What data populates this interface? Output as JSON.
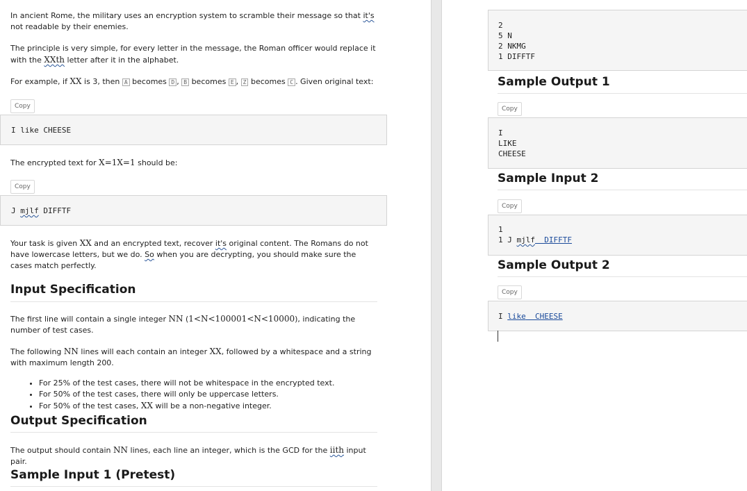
{
  "left": {
    "intro_a": "In ancient Rome, the military uses an encryption system to scramble their message so that ",
    "intro_its": "it's",
    "intro_b": " not readable by their enemies.",
    "principle_a": "The principle is very simple, for every letter in the message, the Roman officer would replace it with the ",
    "principle_xth": "XXth",
    "principle_b": " letter after it in the alphabet.",
    "example_a": "For example, if ",
    "example_x": "XX",
    "example_b": " is 3, then ",
    "kbd_A": "A",
    "becomes1": " becomes ",
    "kbd_D": "D",
    "sep1": ", ",
    "kbd_B": "B",
    "becomes2": " becomes ",
    "kbd_E": "E",
    "sep2": ", ",
    "kbd_Z": "Z",
    "becomes3": " becomes ",
    "kbd_C": "C",
    "example_c": ". Given original text:",
    "copy_label": "Copy",
    "code1": "I like CHEESE",
    "encrypted_a": "The encrypted text for ",
    "encrypted_math": "X=1X=1",
    "encrypted_b": " should be:",
    "code2_a": "J ",
    "code2_misspelled": "mjlf",
    "code2_b": " DIFFTF",
    "task_a": "Your task is given ",
    "task_x": "XX",
    "task_b": " and an encrypted text, recover ",
    "task_its": "it's",
    "task_c": " original content. The Romans do not have lowercase letters, but we do. ",
    "task_so": "So",
    "task_d": " when you are decrypting, you should make sure the cases match perfectly.",
    "input_heading": "Input Specification",
    "input1_a": "The first line will contain a single integer ",
    "input1_n": "NN",
    "input1_paren": " (",
    "input1_math": "1<N<100001<N<10000",
    "input1_b": "), indicating the number of test cases.",
    "input2_a": "The following ",
    "input2_n": "NN",
    "input2_b": " lines will each contain an integer ",
    "input2_x": "XX",
    "input2_c": ", followed by a whitespace and a string with maximum length 200.",
    "bullets": [
      "For 25% of the test cases, there will not be whitespace in the encrypted text.",
      "For 50% of the test cases, there will only be uppercase letters."
    ],
    "bullet3_a": "For 50% of the test cases, ",
    "bullet3_x": "XX",
    "bullet3_b": " will be a non-negative integer.",
    "output_heading": "Output Specification",
    "output_a": "The output should contain ",
    "output_n": "NN",
    "output_b": " lines, each line an integer, which is the GCD for the ",
    "output_ith": "iith",
    "output_c": " input pair.",
    "sample1_heading": "Sample Input 1 (Pretest)"
  },
  "right": {
    "code_input1": "2\n5 N\n2 NKMG\n1 DIFFTF",
    "sample_output1_heading": "Sample Output 1",
    "copy_label": "Copy",
    "code_output1": "I\nLIKE\nCHEESE",
    "sample_input2_heading": "Sample Input 2",
    "code_input2_line1": "1",
    "code_input2_a": "1 J ",
    "code_input2_misspelled": "mjlf",
    "code_input2_b": "  DIFFTF",
    "sample_output2_heading": "Sample Output 2",
    "code_output2_a": "I ",
    "code_output2_like": "like",
    "code_output2_b": "  CHEESE"
  }
}
